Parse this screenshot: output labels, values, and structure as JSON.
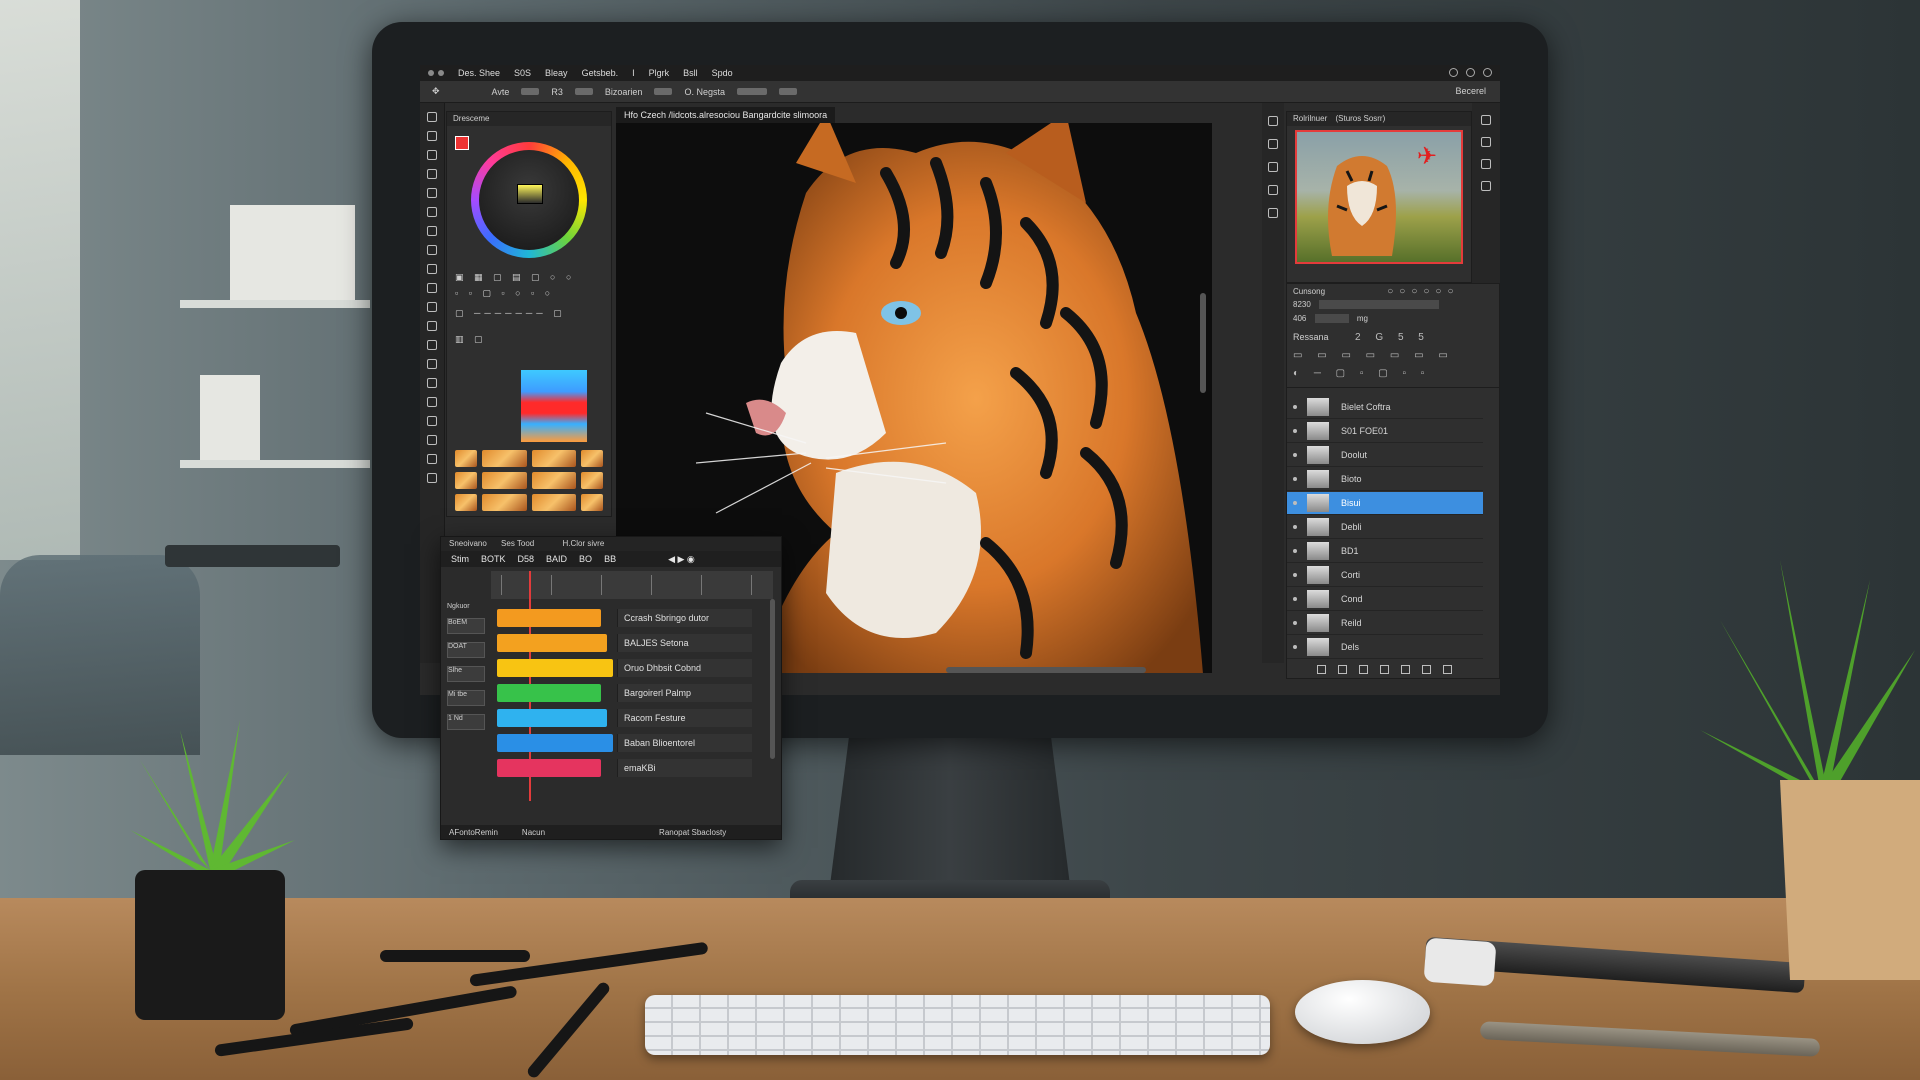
{
  "menubar": {
    "items": [
      "Des. Shee",
      "S0S",
      "Bleay",
      "Getsbeb.",
      "I",
      "Plgrk",
      "Bsll",
      "Spdo"
    ]
  },
  "optbar": {
    "label_1": "Avte",
    "label_2": "R3",
    "label_3": "Bizoarien",
    "label_4": "O. Negsta",
    "right_label": "Becerel"
  },
  "swatch_panel": {
    "title": "Dresceme"
  },
  "document_tab": {
    "title": "Hfo Czech /lidcots.alresociou Bangardcite slimoora"
  },
  "navigator": {
    "title": "Rolrilnuer",
    "subtitle": "(Sturos Sosrr)"
  },
  "properties": {
    "title": "Cunsong",
    "row1_value": "8230",
    "row2_value": "406",
    "row2_unit": "mg",
    "section": "Ressana",
    "section_glyphs": "2 G 5 5"
  },
  "layers": [
    {
      "name": "Bielet Coftra",
      "active": false
    },
    {
      "name": "S01 FOE01",
      "active": false
    },
    {
      "name": "Doolut",
      "active": false
    },
    {
      "name": "Bioto",
      "active": false
    },
    {
      "name": "Bisui",
      "active": true
    },
    {
      "name": "Debli",
      "active": false
    },
    {
      "name": "BD1",
      "active": false
    },
    {
      "name": "Corti",
      "active": false
    },
    {
      "name": "Cond",
      "active": false
    },
    {
      "name": "Reild",
      "active": false
    },
    {
      "name": "Dels",
      "active": false
    }
  ],
  "timeline": {
    "head1_left": "Sneoivano",
    "head1_mid": "Ses Tood",
    "head1_right": "H.Clor sivre",
    "head2": [
      "Stim",
      "BOTK",
      "D58",
      "BAID",
      "BO",
      "BB"
    ],
    "side_label": "Ngkuor",
    "side_items": [
      "BoEM",
      "DOAT",
      "Slhe",
      "Mi tbe",
      "1 Nd"
    ],
    "tracks": [
      {
        "label": "Ccrash Sbringo dutor",
        "color": "#f39a1f"
      },
      {
        "label": "BALJES Setona",
        "color": "#f3a11f"
      },
      {
        "label": "Oruo Dhbsit Cobnd",
        "color": "#f8c412"
      },
      {
        "label": "Bargoirerl Palmp",
        "color": "#37c24a"
      },
      {
        "label": "Racom Festure",
        "color": "#2fb2ef"
      },
      {
        "label": "Baban Blioentorel",
        "color": "#2a8fe6"
      },
      {
        "label": "emaKBi",
        "color": "#e5345f"
      }
    ],
    "footer": [
      "AFontoRemin",
      "Nacun",
      "Ranopat Sbaclosty"
    ]
  }
}
